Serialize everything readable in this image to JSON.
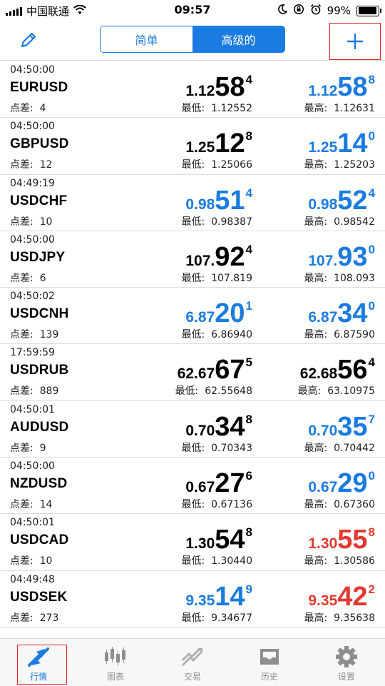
{
  "status": {
    "carrier": "中国联通",
    "time": "09:57",
    "battery": "99%"
  },
  "header": {
    "tab_simple": "简单",
    "tab_advanced": "高级的",
    "active_tab": "高级的"
  },
  "quotes": [
    {
      "time": "04:50:00",
      "symbol": "EURUSD",
      "spread_label": "点差:",
      "spread": "4",
      "bid": {
        "p1": "1.12",
        "p2": "58",
        "p3": "4",
        "color": "black"
      },
      "ask": {
        "p1": "1.12",
        "p2": "58",
        "p3": "8",
        "color": "blue"
      },
      "low_label": "最低:",
      "low": "1.12552",
      "high_label": "最高:",
      "high": "1.12631"
    },
    {
      "time": "04:50:00",
      "symbol": "GBPUSD",
      "spread_label": "点差:",
      "spread": "12",
      "bid": {
        "p1": "1.25",
        "p2": "12",
        "p3": "8",
        "color": "black"
      },
      "ask": {
        "p1": "1.25",
        "p2": "14",
        "p3": "0",
        "color": "blue"
      },
      "low_label": "最低:",
      "low": "1.25066",
      "high_label": "最高:",
      "high": "1.25203"
    },
    {
      "time": "04:49:19",
      "symbol": "USDCHF",
      "spread_label": "点差:",
      "spread": "10",
      "bid": {
        "p1": "0.98",
        "p2": "51",
        "p3": "4",
        "color": "blue"
      },
      "ask": {
        "p1": "0.98",
        "p2": "52",
        "p3": "4",
        "color": "blue"
      },
      "low_label": "最低:",
      "low": "0.98387",
      "high_label": "最高:",
      "high": "0.98542"
    },
    {
      "time": "04:50:00",
      "symbol": "USDJPY",
      "spread_label": "点差:",
      "spread": "6",
      "bid": {
        "p1": "107.",
        "p2": "92",
        "p3": "4",
        "color": "black"
      },
      "ask": {
        "p1": "107.",
        "p2": "93",
        "p3": "0",
        "color": "blue"
      },
      "low_label": "最低:",
      "low": "107.819",
      "high_label": "最高:",
      "high": "108.093"
    },
    {
      "time": "04:50:02",
      "symbol": "USDCNH",
      "spread_label": "点差:",
      "spread": "139",
      "bid": {
        "p1": "6.87",
        "p2": "20",
        "p3": "1",
        "color": "blue"
      },
      "ask": {
        "p1": "6.87",
        "p2": "34",
        "p3": "0",
        "color": "blue"
      },
      "low_label": "最低:",
      "low": "6.86940",
      "high_label": "最高:",
      "high": "6.87590"
    },
    {
      "time": "17:59:59",
      "symbol": "USDRUB",
      "spread_label": "点差:",
      "spread": "889",
      "bid": {
        "p1": "62.67",
        "p2": "67",
        "p3": "5",
        "color": "black"
      },
      "ask": {
        "p1": "62.68",
        "p2": "56",
        "p3": "4",
        "color": "black"
      },
      "low_label": "最低:",
      "low": "62.55648",
      "high_label": "最高:",
      "high": "63.10975"
    },
    {
      "time": "04:50:01",
      "symbol": "AUDUSD",
      "spread_label": "点差:",
      "spread": "9",
      "bid": {
        "p1": "0.70",
        "p2": "34",
        "p3": "8",
        "color": "black"
      },
      "ask": {
        "p1": "0.70",
        "p2": "35",
        "p3": "7",
        "color": "blue"
      },
      "low_label": "最低:",
      "low": "0.70343",
      "high_label": "最高:",
      "high": "0.70442"
    },
    {
      "time": "04:50:00",
      "symbol": "NZDUSD",
      "spread_label": "点差:",
      "spread": "14",
      "bid": {
        "p1": "0.67",
        "p2": "27",
        "p3": "6",
        "color": "black"
      },
      "ask": {
        "p1": "0.67",
        "p2": "29",
        "p3": "0",
        "color": "blue"
      },
      "low_label": "最低:",
      "low": "0.67136",
      "high_label": "最高:",
      "high": "0.67360"
    },
    {
      "time": "04:50:01",
      "symbol": "USDCAD",
      "spread_label": "点差:",
      "spread": "10",
      "bid": {
        "p1": "1.30",
        "p2": "54",
        "p3": "8",
        "color": "black"
      },
      "ask": {
        "p1": "1.30",
        "p2": "55",
        "p3": "8",
        "color": "red"
      },
      "low_label": "最低:",
      "low": "1.30440",
      "high_label": "最高:",
      "high": "1.30586"
    },
    {
      "time": "04:49:48",
      "symbol": "USDSEK",
      "spread_label": "点差:",
      "spread": "273",
      "bid": {
        "p1": "9.35",
        "p2": "14",
        "p3": "9",
        "color": "blue"
      },
      "ask": {
        "p1": "9.35",
        "p2": "42",
        "p3": "2",
        "color": "red"
      },
      "low_label": "最低:",
      "low": "9.34677",
      "high_label": "最高:",
      "high": "9.35638"
    }
  ],
  "tabbar": {
    "quotes": "行情",
    "chart": "图表",
    "trade": "交易",
    "history": "历史",
    "settings": "设置",
    "active": "行情"
  },
  "colors": {
    "accent": "#1a7be0",
    "down": "#e03a30",
    "highlight_box": "#e02020"
  }
}
